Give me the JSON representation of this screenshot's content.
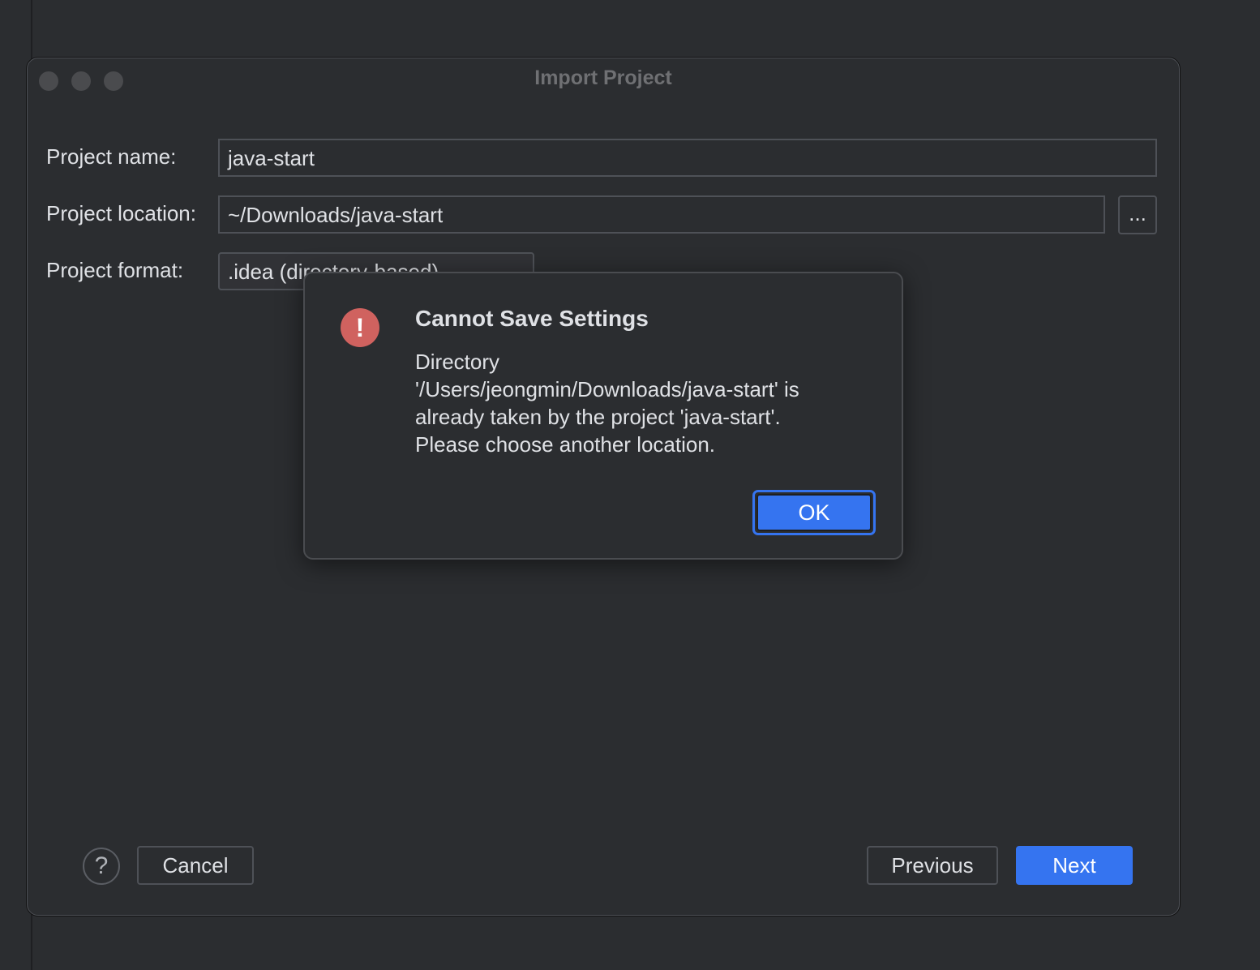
{
  "window": {
    "title": "Import Project"
  },
  "form": {
    "name_label": "Project name:",
    "name_value": "java-start",
    "location_label": "Project location:",
    "location_value": "~/Downloads/java-start",
    "browse_label": "...",
    "format_label": "Project format:",
    "format_value": ".idea (directory-based)"
  },
  "footer": {
    "help": "?",
    "cancel": "Cancel",
    "previous": "Previous",
    "next": "Next"
  },
  "dialog": {
    "title": "Cannot Save Settings",
    "lines": [
      "Directory",
      "'/Users/jeongmin/Downloads/java-start' is",
      "already taken by the project 'java-start'.",
      "Please choose another location."
    ],
    "ok": "OK",
    "icon": "!",
    "icon_color": "#d0625f"
  },
  "colors": {
    "accent": "#3574f0",
    "background": "#2b2d30"
  }
}
